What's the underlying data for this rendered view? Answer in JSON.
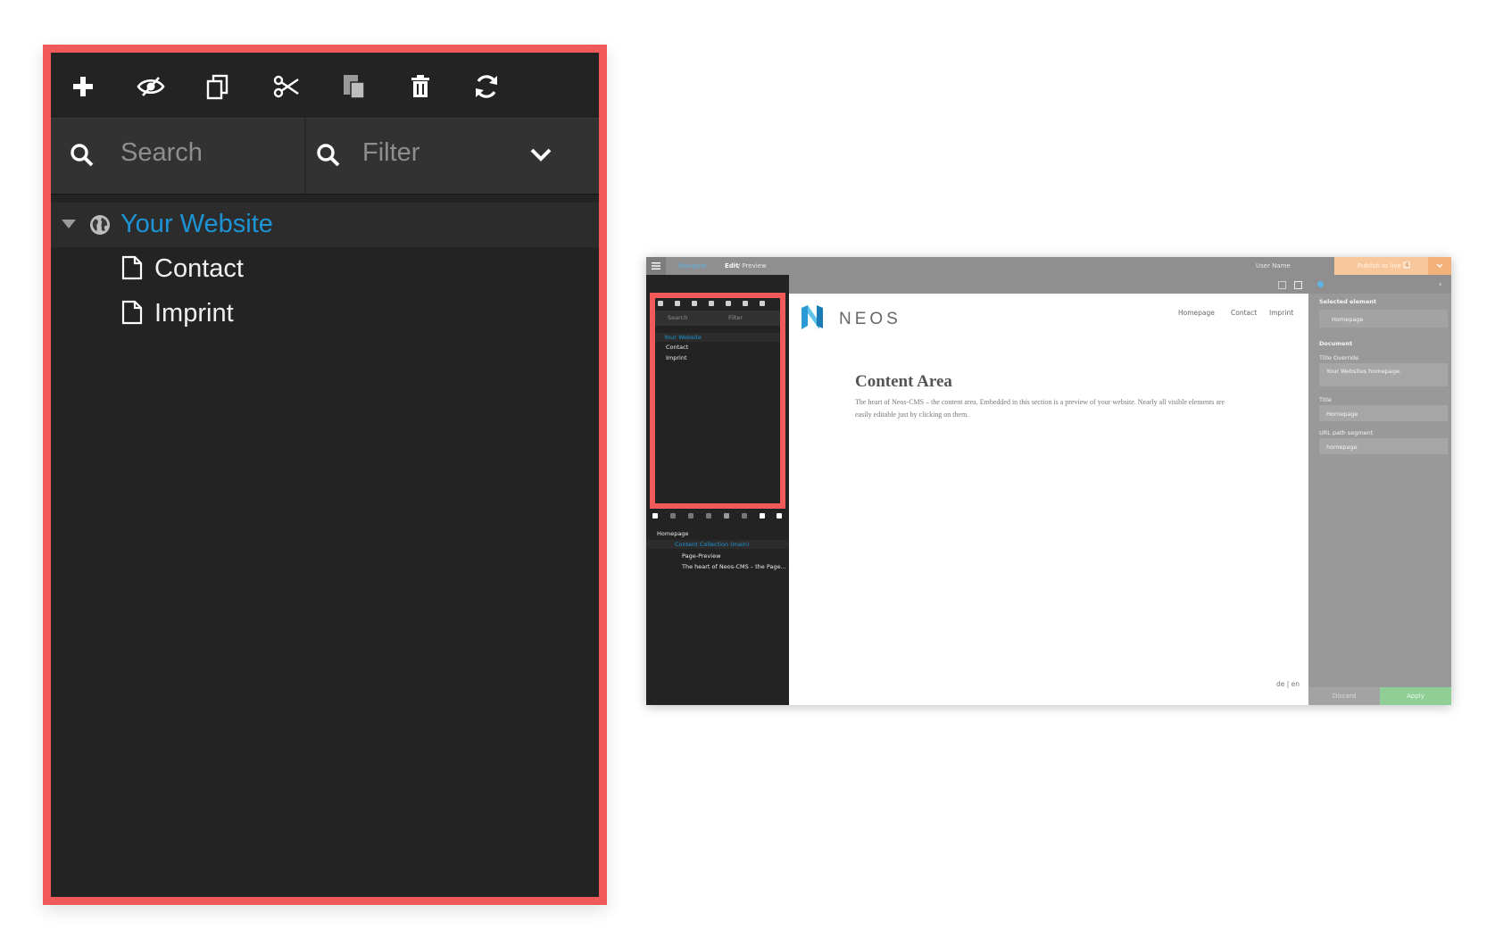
{
  "zoom": {
    "toolbar_icons": [
      "plus-icon",
      "eye-slash-icon",
      "copy-icon",
      "scissors-icon",
      "paste-icon",
      "trash-icon",
      "refresh-icon"
    ],
    "search_placeholder": "Search",
    "filter_placeholder": "Filter",
    "tree": {
      "root": "Your Website",
      "children": [
        "Contact",
        "Imprint"
      ]
    }
  },
  "app": {
    "topbar": {
      "navigate": "Navigate",
      "edit": "Edit",
      "preview": "/ Preview",
      "user": "User Name",
      "publish": "Publish to live",
      "publish_count": "4"
    },
    "left_search": "Search",
    "left_filter": "Filter",
    "doc_tree": {
      "root": "Your Website",
      "children": [
        "Contact",
        "Imprint"
      ]
    },
    "content_tree": {
      "page": "Homepage",
      "collection": "Content Collection (main)",
      "items": [
        "Page-Preview",
        "The heart of Neos-CMS – the Page..."
      ]
    },
    "site": {
      "logo_text": "NEOS",
      "nav": [
        "Homepage",
        "Contact",
        "Imprint"
      ],
      "heading": "Content Area",
      "body": "The heart of Neos-CMS – the content area. Embedded in this section is a preview of your website. Nearly all visible elements are easily editable just by clicking on them.",
      "lang": "de | en"
    },
    "inspector": {
      "selected_label": "Selected element",
      "selected_value": "Homepage",
      "section": "Document",
      "title_override_label": "Title Override",
      "title_override_value": "Your Websites homepage.",
      "title_label": "Title",
      "title_value": "Homepage",
      "url_label": "URL path segment",
      "url_value": "homepage",
      "discard": "Discard",
      "apply": "Apply"
    }
  },
  "colors": {
    "accent": "#f25a5a",
    "panel": "#232323",
    "link": "#1d94d6",
    "publish": "#f8c79b",
    "apply": "#8fcf95"
  }
}
